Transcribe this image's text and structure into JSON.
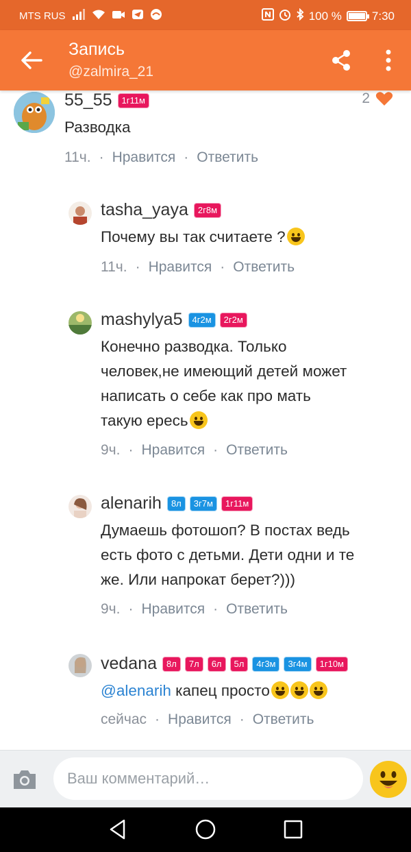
{
  "status_bar": {
    "carrier": "MTS RUS",
    "battery": "100 %",
    "battery_level": 1.0,
    "time": "7:30",
    "icons": [
      "signal-icon",
      "wifi-icon",
      "camera-status-icon",
      "send-status-icon",
      "bank-app-icon",
      "nfc-icon",
      "alarm-icon",
      "bluetooth-icon",
      "battery-icon"
    ]
  },
  "header": {
    "title": "Запись",
    "subtitle": "@zalmira_21",
    "icons": [
      "back-arrow-icon",
      "share-icon",
      "more-vertical-icon"
    ]
  },
  "comments": [
    {
      "author": "55_55",
      "badges": [
        {
          "text": "1г11м",
          "color": "pink"
        }
      ],
      "text": "Разводка",
      "time": "11ч.",
      "like_label": "Нравится",
      "reply_label": "Ответить",
      "likes": "2"
    },
    {
      "author": "tasha_yaya",
      "badges": [
        {
          "text": "2г8м",
          "color": "pink"
        }
      ],
      "text": "Почему вы так считаете ?",
      "time": "11ч.",
      "like_label": "Нравится",
      "reply_label": "Ответить"
    },
    {
      "author": "mashylya5",
      "badges": [
        {
          "text": "4г2м",
          "color": "blue"
        },
        {
          "text": "2г2м",
          "color": "pink"
        }
      ],
      "text_lines": [
        "Конечно разводка. Только",
        "человек,не имеющий детей может",
        "написать о себе как  про мать",
        "такую ересь"
      ],
      "time": "9ч.",
      "like_label": "Нравится",
      "reply_label": "Ответить"
    },
    {
      "author": "alenarih",
      "badges": [
        {
          "text": "8л",
          "color": "blue"
        },
        {
          "text": "3г7м",
          "color": "blue"
        },
        {
          "text": "1г11м",
          "color": "pink"
        }
      ],
      "text_lines": [
        "Думаешь фотошоп? В постах ведь",
        "есть фото с детьми. Дети одни и те",
        "же. Или напрокат берет?)))"
      ],
      "time": "9ч.",
      "like_label": "Нравится",
      "reply_label": "Ответить"
    },
    {
      "author": "vedana",
      "badges": [
        {
          "text": "8л",
          "color": "pink"
        },
        {
          "text": "7л",
          "color": "pink"
        },
        {
          "text": "6л",
          "color": "pink"
        },
        {
          "text": "5л",
          "color": "pink"
        },
        {
          "text": "4г3м",
          "color": "blue"
        },
        {
          "text": "3г4м",
          "color": "blue"
        },
        {
          "text": "1г10м",
          "color": "pink"
        }
      ],
      "mention": "@alenarih",
      "text": " капец просто",
      "time": "сейчас",
      "like_label": "Нравится",
      "reply_label": "Ответить"
    }
  ],
  "composer": {
    "placeholder": "Ваш комментарий…",
    "icons": [
      "camera-icon",
      "emoji-icon"
    ]
  },
  "colors": {
    "status_bar": "#e5672b",
    "app_bar": "#f57737",
    "badge_pink": "#e8175d",
    "badge_blue": "#1a93e2",
    "mention": "#2b83d2",
    "like_heart": "#f57737"
  }
}
